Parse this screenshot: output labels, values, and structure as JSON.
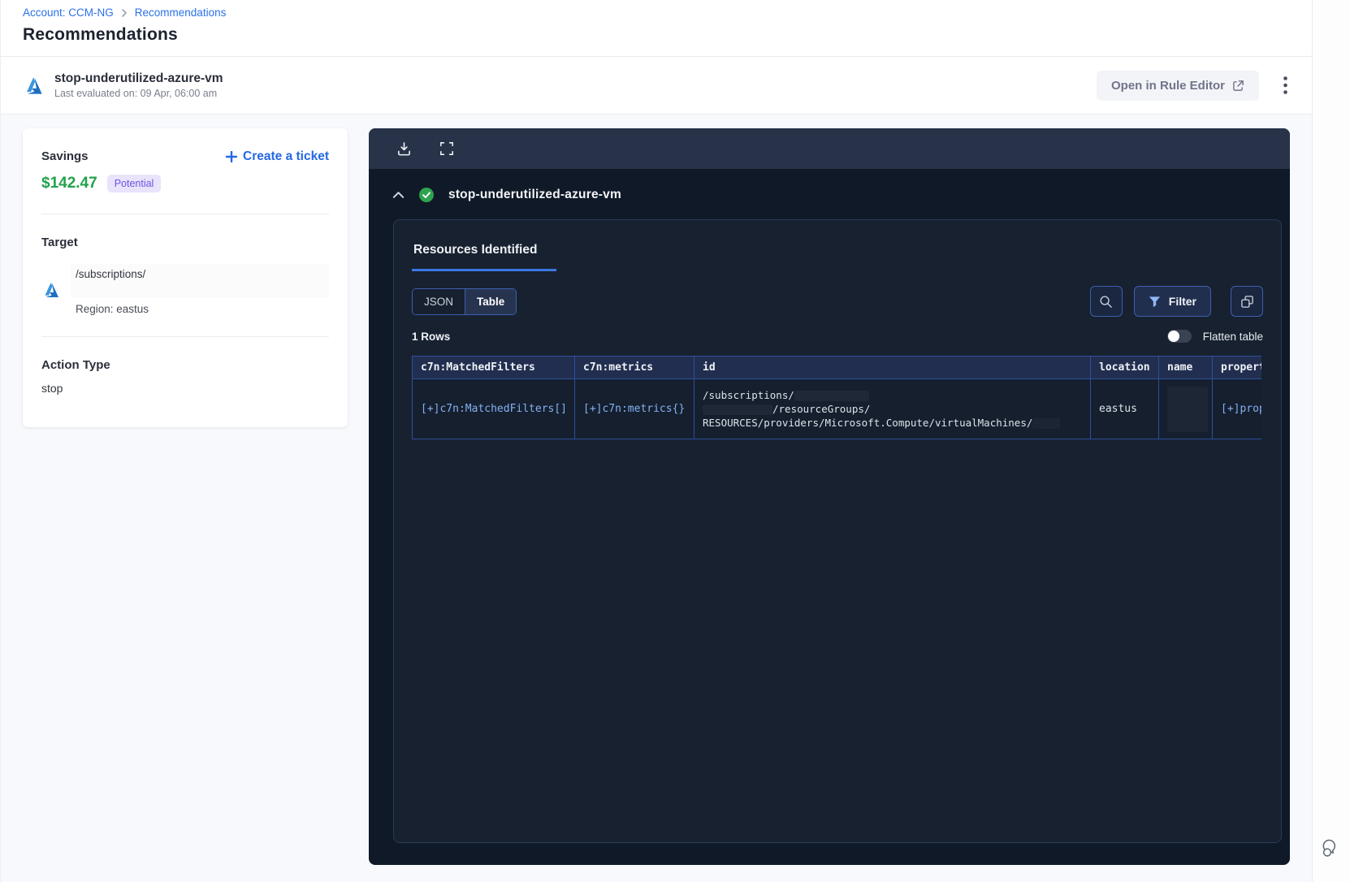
{
  "breadcrumb": {
    "account_link": "Account: CCM-NG",
    "current": "Recommendations"
  },
  "page_title": "Recommendations",
  "recommendation_header": {
    "title": "stop-underutilized-azure-vm",
    "subtitle": "Last evaluated on: 09 Apr, 06:00 am",
    "open_rule_editor_label": "Open in Rule Editor"
  },
  "savings_card": {
    "savings_label": "Savings",
    "amount": "$142.47",
    "badge": "Potential",
    "create_ticket_label": "Create a ticket",
    "target_label": "Target",
    "target_path": "/subscriptions/",
    "region": "Region: eastus",
    "action_type_label": "Action Type",
    "action_type_value": "stop"
  },
  "results_panel": {
    "title": "stop-underutilized-azure-vm",
    "tab_label": "Resources Identified",
    "view_toggle": {
      "json_label": "JSON",
      "table_label": "Table",
      "active": "Table"
    },
    "filter_label": "Filter",
    "rows_count": "1 Rows",
    "flatten_label": "Flatten table",
    "table": {
      "columns": [
        "c7n:MatchedFilters",
        "c7n:metrics",
        "id",
        "location",
        "name",
        "propert"
      ],
      "row": {
        "matched_filters": "[+]c7n:MatchedFilters[]",
        "metrics": "[+]c7n:metrics{}",
        "id_line1": "/subscriptions/",
        "id_line2": "/resourceGroups/",
        "id_line3": "RESOURCES/providers/Microsoft.Compute/virtualMachines/",
        "location": "eastus",
        "name": "",
        "properties": "[+]prop"
      }
    }
  },
  "colors": {
    "link_blue": "#2b71e8",
    "savings_green": "#23a14c",
    "badge_bg": "#e9e4fb",
    "badge_text": "#6b54e0",
    "success_green": "#2fa24f",
    "panel_bg": "#101927",
    "panel_inner_bg": "#172130",
    "table_border_blue": "#2f4f9c",
    "expander_blue": "#85b1f3",
    "tab_underline": "#3a77e0"
  }
}
